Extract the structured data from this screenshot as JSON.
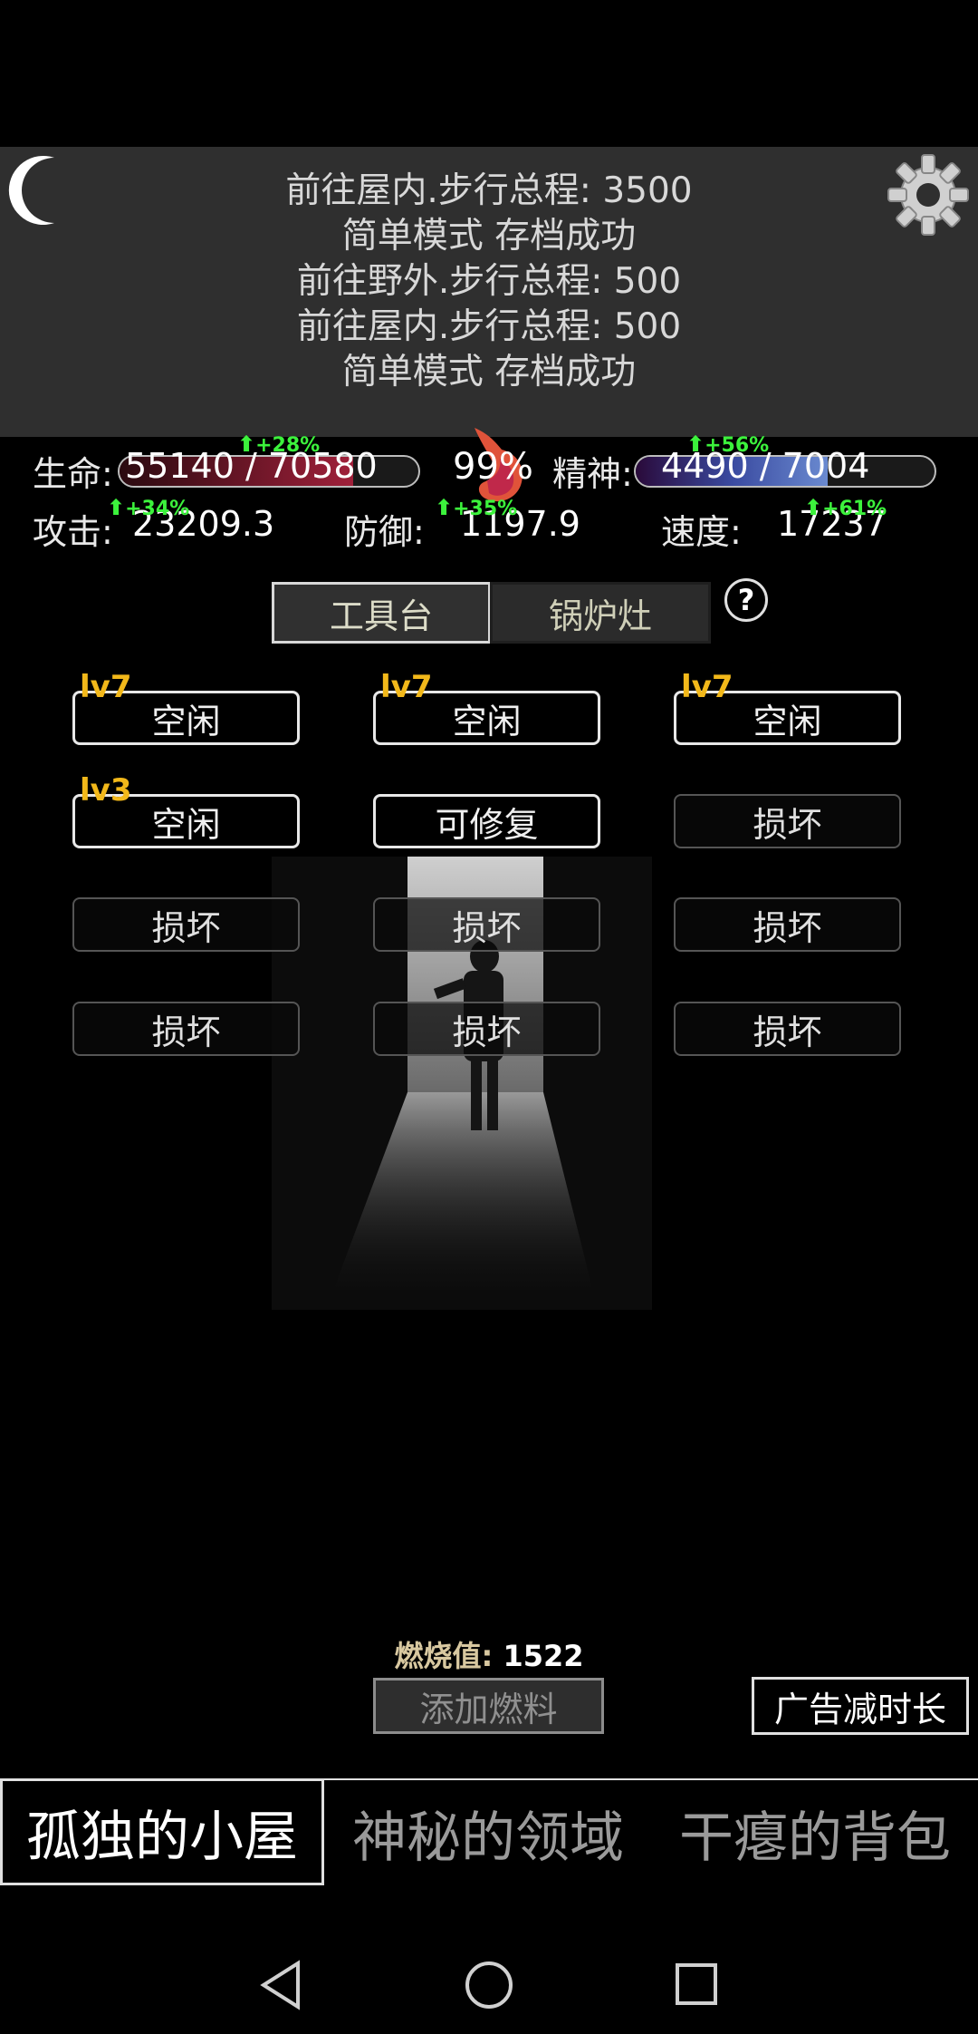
{
  "log": {
    "lines": [
      "前往屋内.步行总程: 3500",
      "简单模式 存档成功",
      "前往野外.步行总程: 500",
      "前往屋内.步行总程: 500",
      "简单模式 存档成功"
    ]
  },
  "stats": {
    "life_label": "生命:",
    "life_value": "55140 / 70580",
    "life_fraction": 0.781,
    "life_buff": "+28%",
    "hunger_percent": "99%",
    "spirit_label": "精神:",
    "spirit_value": "4490 / 7004",
    "spirit_fraction": 0.641,
    "spirit_buff": "+56%",
    "attack_label": "攻击:",
    "attack_value": "23209.3",
    "attack_buff": "+34%",
    "defense_label": "防御:",
    "defense_value": "1197.9",
    "defense_buff": "+35%",
    "speed_label": "速度:",
    "speed_value": "17237",
    "speed_buff": "+61%"
  },
  "tabs": {
    "workbench": "工具台",
    "boiler": "锅炉灶",
    "help": "?"
  },
  "slots": [
    {
      "level": "lv7",
      "label": "空闲",
      "state": "idle"
    },
    {
      "level": "lv7",
      "label": "空闲",
      "state": "idle"
    },
    {
      "level": "lv7",
      "label": "空闲",
      "state": "idle"
    },
    {
      "level": "lv3",
      "label": "空闲",
      "state": "idle"
    },
    {
      "level": "",
      "label": "可修复",
      "state": "idle"
    },
    {
      "level": "",
      "label": "损坏",
      "state": "broken"
    },
    {
      "level": "",
      "label": "损坏",
      "state": "broken"
    },
    {
      "level": "",
      "label": "损坏",
      "state": "broken"
    },
    {
      "level": "",
      "label": "损坏",
      "state": "broken"
    },
    {
      "level": "",
      "label": "损坏",
      "state": "broken"
    },
    {
      "level": "",
      "label": "损坏",
      "state": "broken"
    },
    {
      "level": "",
      "label": "损坏",
      "state": "broken"
    }
  ],
  "fuel": {
    "burn_label": "燃烧值:",
    "burn_value": "1522",
    "add_fuel": "添加燃料",
    "ad_reduce": "广告减时长"
  },
  "bottom_nav": {
    "cabin": "孤独的小屋",
    "domain": "神秘的领域",
    "bag": "干瘪的背包"
  },
  "colors": {
    "life_bar": "#a0203a",
    "spirit_bar": "#3a4aa0",
    "buff_green": "#3cf23c",
    "level_gold": "#f2b81a"
  }
}
